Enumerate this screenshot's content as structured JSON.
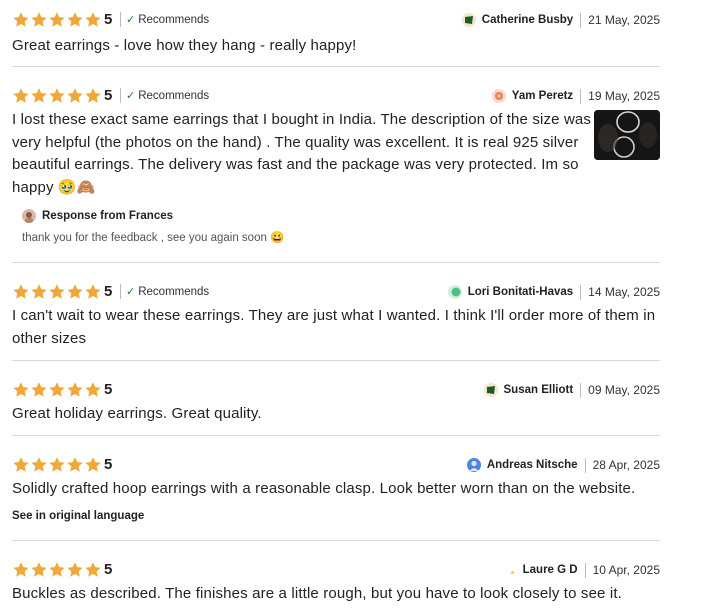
{
  "colors": {
    "star": "#f1a83b",
    "check": "#2e7d32",
    "divider": "#d9d9d9"
  },
  "reviews": [
    {
      "stars": 5,
      "rating": "5",
      "recommends": "Recommends",
      "author": "Catherine Busby",
      "avatar": "leaf-avatar",
      "date": "21 May, 2025",
      "text": "Great earrings - love how they hang - really happy!"
    },
    {
      "stars": 5,
      "rating": "5",
      "recommends": "Recommends",
      "author": "Yam Peretz",
      "avatar": "flower-avatar",
      "date": "19 May, 2025",
      "text_lines": [
        "I lost these exact same earrings that I bought in India. The description of the size was",
        "very helpful (the photos on the hand) . The quality was excellent. It is real 925 silver",
        "beautiful earrings. The delivery was fast and the package was very protected. Im so",
        "happy 🥹🙈"
      ],
      "photo": "hoop-earrings-photo",
      "response_label": "Response from Frances",
      "response_text": "thank you for the feedback , see you again soon 😀"
    },
    {
      "stars": 5,
      "rating": "5",
      "recommends": "Recommends",
      "author": "Lori Bonitati-Havas",
      "avatar": "green-avatar",
      "date": "14 May, 2025",
      "text_lines": [
        "I can't wait to wear these earrings. They are just what I wanted. I think I'll order more of them in",
        "other sizes"
      ]
    },
    {
      "stars": 5,
      "rating": "5",
      "author": "Susan Elliott",
      "avatar": "leaf-avatar",
      "date": "09 May, 2025",
      "text": "Great holiday earrings. Great quality."
    },
    {
      "stars": 5,
      "rating": "5",
      "author": "Andreas Nitsche",
      "avatar": "person-avatar",
      "date": "28 Apr, 2025",
      "text": "Solidly crafted hoop earrings with a reasonable clasp. Look better worn than on the website.",
      "link": "See in original language"
    },
    {
      "stars": 5,
      "rating": "5",
      "author": "Laure G D",
      "avatar": "moon-avatar",
      "date": "10 Apr, 2025",
      "text": "Buckles as described. The finishes are a little rough, but you have to look closely to see it."
    }
  ]
}
